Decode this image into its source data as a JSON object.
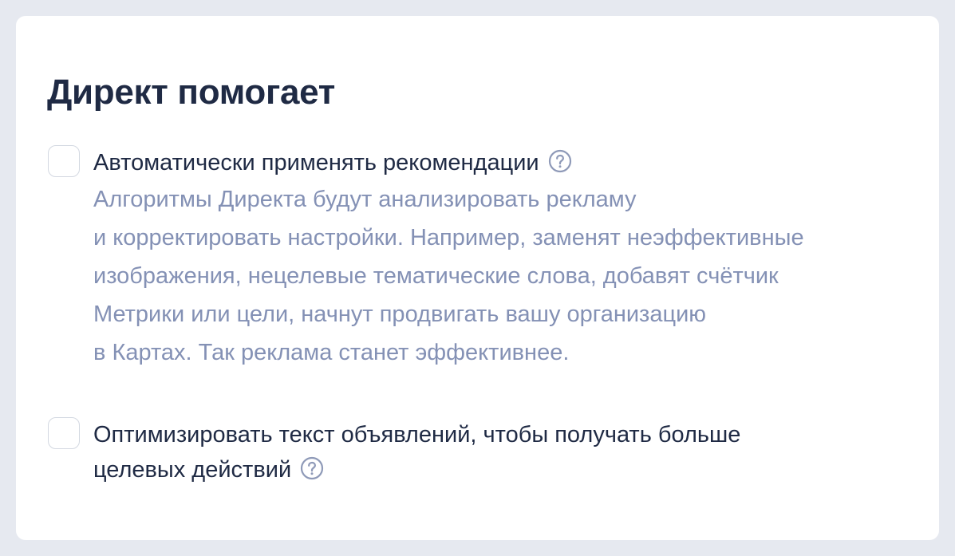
{
  "panel": {
    "title": "Директ помогает"
  },
  "options": [
    {
      "checked": false,
      "label": "Автоматически применять рекомендации",
      "help_icon": "question-circle-icon",
      "description_lines": [
        "Алгоритмы Директа будут анализировать рекламу",
        "и корректировать настройки. Например, заменят неэффективные",
        "изображения, нецелевые тематические слова, добавят счётчик",
        "Метрики или цели, начнут продвигать вашу организацию",
        "в Картах. Так реклама станет эффективнее."
      ]
    },
    {
      "checked": false,
      "label_lines": [
        "Оптимизировать текст объявлений, чтобы получать больше",
        "целевых действий"
      ],
      "help_icon": "question-circle-icon"
    }
  ],
  "colors": {
    "page_background": "#e6e9f0",
    "card_background": "#ffffff",
    "title_text": "#1f2a44",
    "description_text": "#8491b5",
    "icon": "#8f9ab8",
    "checkbox_border": "#d3d8e1"
  }
}
